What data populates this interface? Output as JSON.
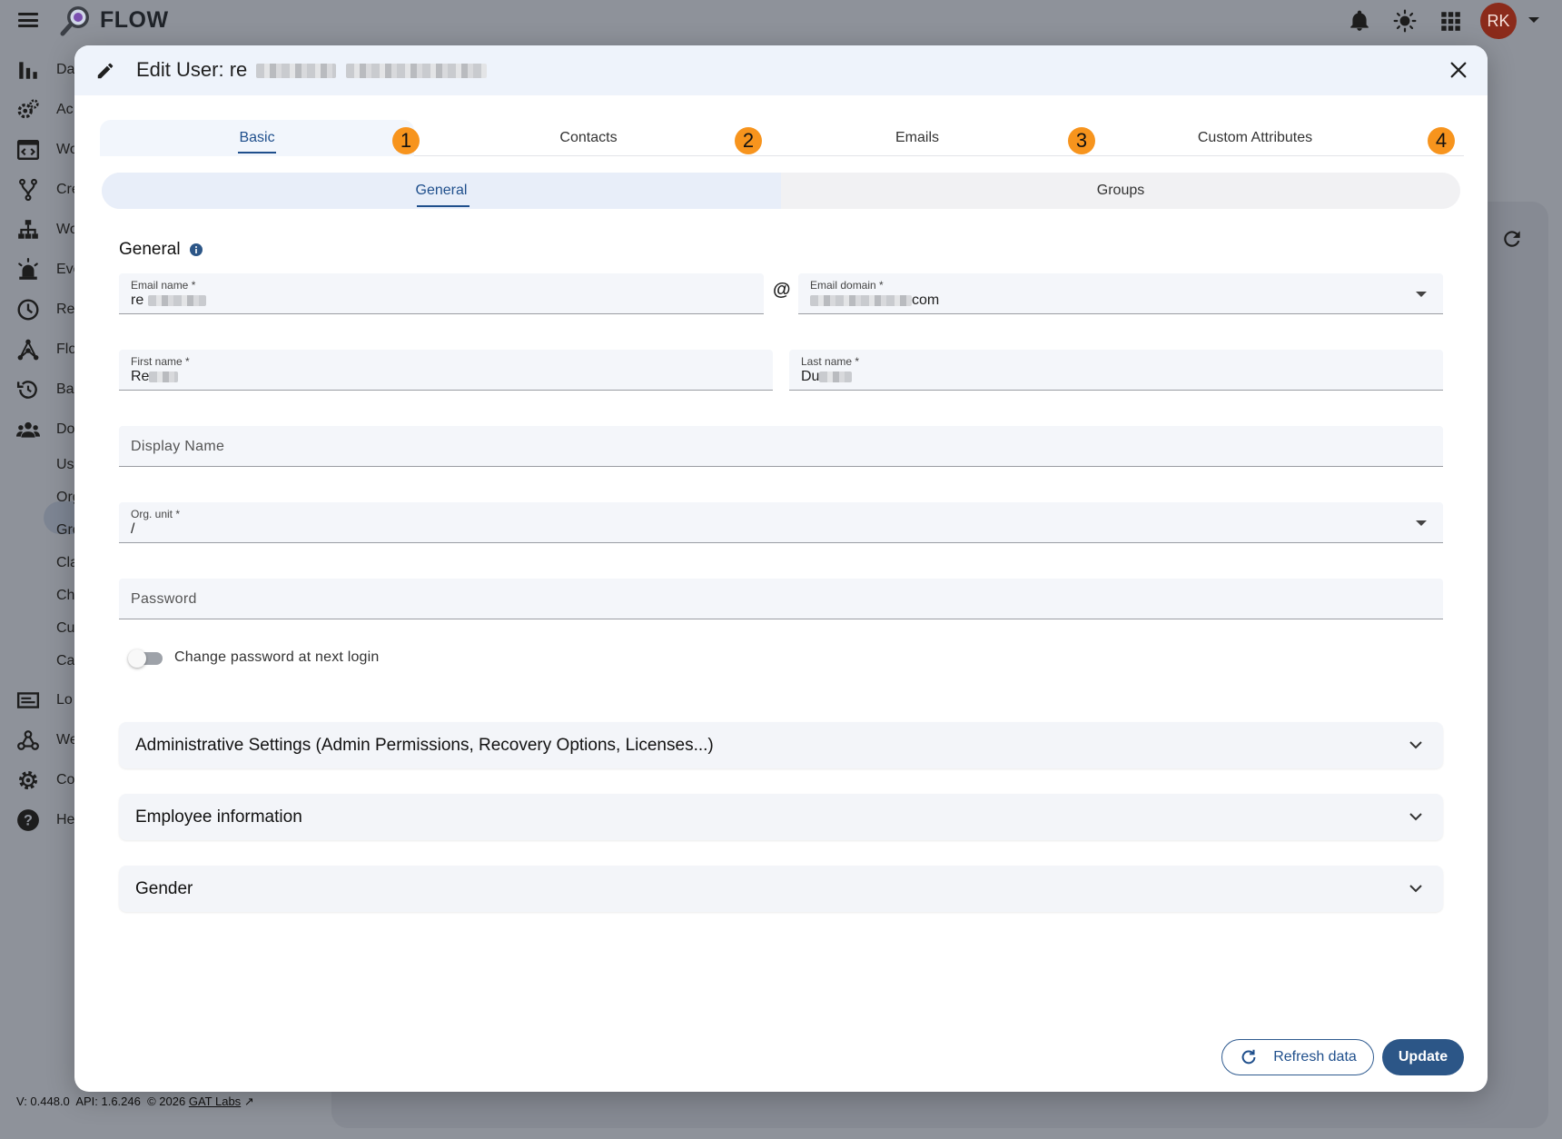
{
  "app": {
    "name": "FLOW",
    "avatar_initials": "RK",
    "avatar_color": "#8b2b1b",
    "icons": [
      "menu-icon",
      "bell-icon",
      "theme-icon",
      "apps-grid-icon"
    ]
  },
  "sidebar": {
    "items": [
      {
        "label": "Da",
        "icon": "bar-chart-icon"
      },
      {
        "label": "Ac",
        "icon": "gears-icon"
      },
      {
        "label": "Wo",
        "icon": "browser-window-icon"
      },
      {
        "label": "Cre",
        "icon": "fork-icon"
      },
      {
        "label": "Wo",
        "icon": "org-chart-icon"
      },
      {
        "label": "Eve",
        "icon": "siren-icon"
      },
      {
        "label": "Re",
        "icon": "clock-icon"
      },
      {
        "label": "Flo",
        "icon": "network-icon"
      },
      {
        "label": "Ba",
        "icon": "restore-icon"
      },
      {
        "label": "Do",
        "icon": "people-icon"
      },
      {
        "label": "Lo",
        "icon": "log-icon"
      },
      {
        "label": "We",
        "icon": "webhook-icon"
      },
      {
        "label": "Co",
        "icon": "settings-icon"
      },
      {
        "label": "He",
        "icon": "help-icon"
      }
    ],
    "sub_items": [
      "Us",
      "Org",
      "Gro",
      "Cla",
      "Ch",
      "Cu",
      "Ca"
    ]
  },
  "footer": {
    "version": "V: 0.448.0",
    "api": "API: 1.6.246",
    "copyright": "© 2026",
    "company_link": "GAT Labs"
  },
  "modal": {
    "title_prefix": "Edit User: re",
    "tabs": [
      {
        "label": "Basic",
        "badge": "1",
        "active": true
      },
      {
        "label": "Contacts",
        "badge": "2",
        "active": false
      },
      {
        "label": "Emails",
        "badge": "3",
        "active": false
      },
      {
        "label": "Custom Attributes",
        "badge": "4",
        "active": false
      }
    ],
    "badge_color": "#f7941d",
    "subtabs": [
      {
        "label": "General",
        "active": true
      },
      {
        "label": "Groups",
        "active": false
      }
    ],
    "section_title": "General",
    "fields": {
      "email_name": {
        "label": "Email name *",
        "value": "re"
      },
      "at": "@",
      "email_domain": {
        "label": "Email domain *",
        "value_suffix": "com"
      },
      "first_name": {
        "label": "First name *",
        "value": "Re"
      },
      "last_name": {
        "label": "Last name *",
        "value": "Du"
      },
      "display_name": {
        "placeholder": "Display Name"
      },
      "org_unit": {
        "label": "Org. unit *",
        "value": "/"
      },
      "password": {
        "placeholder": "Password"
      }
    },
    "change_password_toggle": {
      "label": "Change password at next login",
      "checked": false
    },
    "accordions": [
      "Administrative Settings (Admin Permissions, Recovery Options, Licenses...)",
      "Employee information",
      "Gender"
    ],
    "buttons": {
      "refresh": "Refresh data",
      "update": "Update"
    },
    "accent_color": "#2c5687"
  }
}
